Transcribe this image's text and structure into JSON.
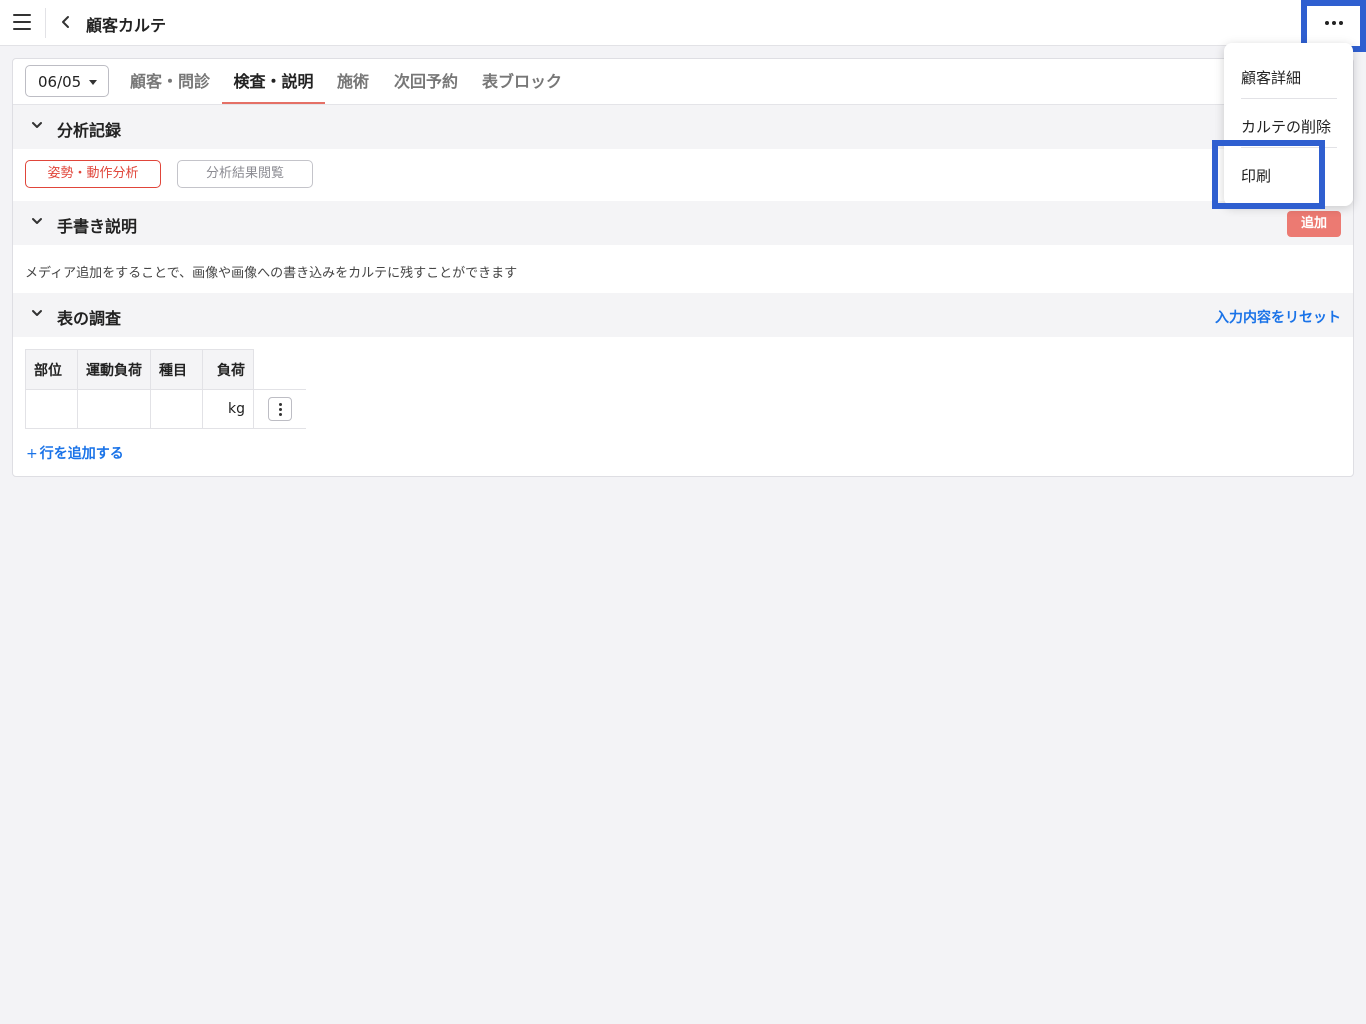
{
  "header": {
    "title": "顧客カルテ"
  },
  "date_select": {
    "value": "06/05"
  },
  "tabs": [
    {
      "label": "顧客・問診"
    },
    {
      "label": "検査・説明"
    },
    {
      "label": "施術"
    },
    {
      "label": "次回予約"
    },
    {
      "label": "表ブロック"
    }
  ],
  "sections": {
    "analysis": {
      "title": "分析記録",
      "posture_button": "姿勢・動作分析",
      "results_button": "分析結果閲覧"
    },
    "handwritten": {
      "title": "手書き説明",
      "add_button": "追加",
      "description": "メディア追加をすることで、画像や画像への書き込みをカルテに残すことができます"
    },
    "survey": {
      "title": "表の調査",
      "reset_link": "入力内容をリセット",
      "columns": [
        "部位",
        "運動負荷",
        "種目",
        "負荷"
      ],
      "row_unit": "kg",
      "add_row": "行を追加する",
      "add_row_prefix": "+"
    }
  },
  "dropdown": {
    "items": [
      "顧客詳細",
      "カルテの削除",
      "印刷"
    ]
  },
  "colors": {
    "accent_red": "#e0453a",
    "add_button": "#ec7a72",
    "link_blue": "#1a73e8",
    "highlight_blue": "#2f5fd0"
  }
}
